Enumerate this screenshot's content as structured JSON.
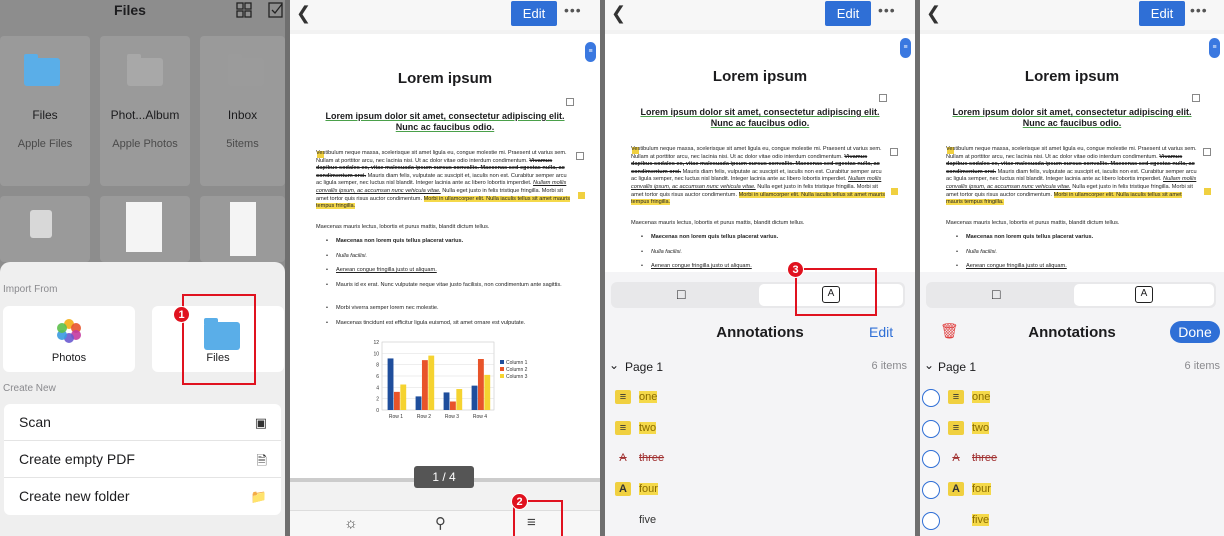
{
  "files_panel": {
    "title": "Files",
    "tiles": [
      {
        "name": "Files",
        "sub": "Apple Files"
      },
      {
        "name": "Phot...Album",
        "sub": "Apple Photos"
      },
      {
        "name": "Inbox",
        "sub": "5items"
      }
    ],
    "import_label": "Import From",
    "import_items": [
      {
        "label": "Photos"
      },
      {
        "label": "Files"
      }
    ],
    "create_label": "Create New",
    "create_items": [
      {
        "label": "Scan"
      },
      {
        "label": "Create empty PDF"
      },
      {
        "label": "Create new folder"
      }
    ]
  },
  "document": {
    "edit_label": "Edit",
    "title": "Lorem ipsum",
    "subtitle": "Lorem ipsum dolor sit amet, consectetur adipiscing elit. Nunc ac faucibus odio.",
    "para1_a": "Vestibulum neque massa, scelerisque sit amet ligula eu, congue molestie mi. Praesent ut varius sem. Nullam at porttitor arcu, nec lacinia nisi. Ut ac dolor vitae odio interdum condimentum.",
    "para1_b": "Vivamus dapibus sodales ex, vitae malesuada ipsum cursus convallis. Maecenas sed egestas nulla, ac condimentum orci.",
    "para1_c": "Mauris diam felis, vulputate ac suscipit et, iaculis non est. Curabitur semper arcu ac ligula semper, nec luctus nisl blandit. Integer lacinia ante ac libero lobortis imperdiet.",
    "para1_d": "Nullam mollis convallis ipsum, ac accumsan nunc vehicula vitae.",
    "para1_e": "Nulla eget justo in felis tristique fringilla. Morbi sit amet tortor quis risus auctor condimentum.",
    "para1_f": "Morbi in ullamcorper elit. Nulla iaculis tellus sit amet mauris tempus fringilla.",
    "para2": "Maecenas mauris lectus, lobortis et purus mattis, blandit dictum tellus.",
    "bullets": [
      "Maecenas non lorem quis tellus placerat varius.",
      "Nulla facilisi.",
      "Aenean congue fringilla justo ut aliquam.",
      "Mauris id ex erat. Nunc vulputate neque vitae justo facilisis, non condimentum ante sagittis.",
      "Morbi viverra semper lorem nec molestie.",
      "Maecenas tincidunt est efficitur ligula euismod, sit amet ornare est vulputate."
    ],
    "page_indicator": "1 / 4"
  },
  "chart_data": {
    "type": "bar",
    "categories": [
      "Row 1",
      "Row 2",
      "Row 3",
      "Row 4"
    ],
    "series": [
      {
        "name": "Column 1",
        "values": [
          9.1,
          2.4,
          3.1,
          4.3
        ]
      },
      {
        "name": "Column 2",
        "values": [
          3.2,
          8.8,
          1.5,
          9.0
        ]
      },
      {
        "name": "Column 3",
        "values": [
          4.5,
          9.6,
          3.7,
          6.2
        ]
      }
    ],
    "ylim": [
      0,
      12
    ],
    "yticks": [
      "0",
      "2",
      "4",
      "6",
      "8",
      "10",
      "12"
    ],
    "colors": [
      "#1f4e9c",
      "#e8542a",
      "#f5d330"
    ]
  },
  "annotations": {
    "title": "Annotations",
    "edit_label": "Edit",
    "done_label": "Done",
    "page_label": "Page 1",
    "count_label": "6 items",
    "items": [
      {
        "label": "one",
        "kind": "note"
      },
      {
        "label": "two",
        "kind": "note"
      },
      {
        "label": "three",
        "kind": "strike"
      },
      {
        "label": "four",
        "kind": "text"
      },
      {
        "label": "five",
        "kind": "highlight"
      }
    ]
  },
  "steps": {
    "one": "1",
    "two": "2",
    "three": "3"
  }
}
